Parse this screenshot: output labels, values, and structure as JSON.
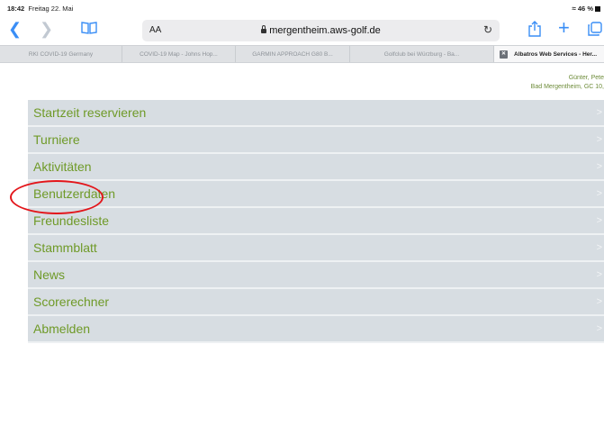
{
  "status_bar": {
    "time": "18:42",
    "date": "Freitag 22. Mai",
    "battery": "46 %"
  },
  "toolbar": {
    "text_size": "AA",
    "url": "mergentheim.aws-golf.de"
  },
  "tabs": [
    {
      "label": "RKI COVID-19 Germany",
      "active": false
    },
    {
      "label": "COVID-19 Map - Johns Hop...",
      "active": false
    },
    {
      "label": "GARMIN APPROACH G80 B...",
      "active": false
    },
    {
      "label": "Golfclub bei Würzburg - Ba...",
      "active": false
    },
    {
      "label": "Albatros Web Services - Her...",
      "active": true
    }
  ],
  "user": {
    "name": "Günter, Pete",
    "club": "Bad Mergentheim, GC   10,"
  },
  "menu": [
    {
      "label": "Startzeit reservieren"
    },
    {
      "label": "Turniere"
    },
    {
      "label": "Aktivitäten"
    },
    {
      "label": "Benutzerdaten"
    },
    {
      "label": "Freundesliste"
    },
    {
      "label": "Stammblatt"
    },
    {
      "label": "News"
    },
    {
      "label": "Scorerechner"
    },
    {
      "label": "Abmelden"
    }
  ],
  "colors": {
    "menu_text": "#6f9a28",
    "menu_bg": "#d7dde2",
    "accent": "#3a8ef6",
    "annotation": "#e3161b"
  },
  "chevron": ">"
}
